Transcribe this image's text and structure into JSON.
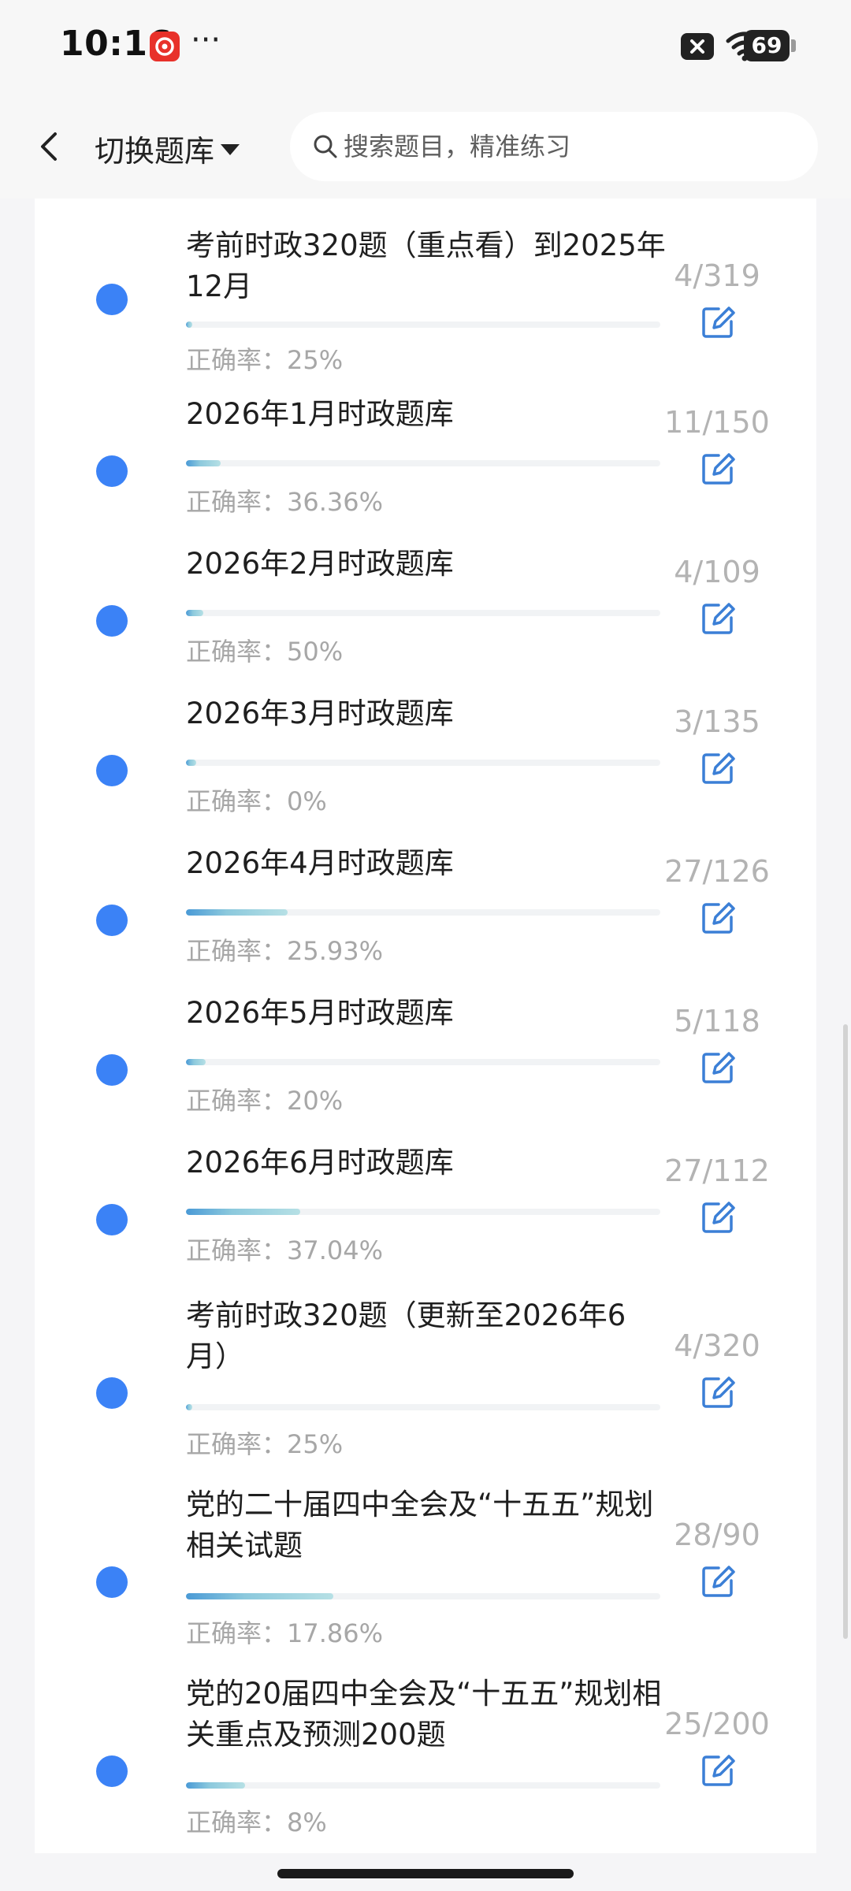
{
  "status_bar": {
    "time": "10:16",
    "dots": "···",
    "battery": "69"
  },
  "header": {
    "bank_switch_label": "切换题库",
    "search_placeholder": "搜索题目，精准练习"
  },
  "items": [
    {
      "title": "考前时政320题（重点看）到2025年12月",
      "accuracy": "正确率：25%",
      "count": "4/319",
      "progress": 0.0125
    },
    {
      "title": "2026年1月时政题库",
      "accuracy": "正确率：36.36%",
      "count": "11/150",
      "progress": 0.073
    },
    {
      "title": "2026年2月时政题库",
      "accuracy": "正确率：50%",
      "count": "4/109",
      "progress": 0.037
    },
    {
      "title": "2026年3月时政题库",
      "accuracy": "正确率：0%",
      "count": "3/135",
      "progress": 0.022
    },
    {
      "title": "2026年4月时政题库",
      "accuracy": "正确率：25.93%",
      "count": "27/126",
      "progress": 0.214
    },
    {
      "title": "2026年5月时政题库",
      "accuracy": "正确率：20%",
      "count": "5/118",
      "progress": 0.042
    },
    {
      "title": "2026年6月时政题库",
      "accuracy": "正确率：37.04%",
      "count": "27/112",
      "progress": 0.241
    },
    {
      "title": "考前时政320题（更新至2026年6月）",
      "accuracy": "正确率：25%",
      "count": "4/320",
      "progress": 0.0125
    },
    {
      "title": "党的二十届四中全会及“十五五”规划相关试题",
      "accuracy": "正确率：17.86%",
      "count": "28/90",
      "progress": 0.311
    },
    {
      "title": "党的20届四中全会及“十五五”规划相关重点及预测200题",
      "accuracy": "正确率：8%",
      "count": "25/200",
      "progress": 0.125
    }
  ]
}
